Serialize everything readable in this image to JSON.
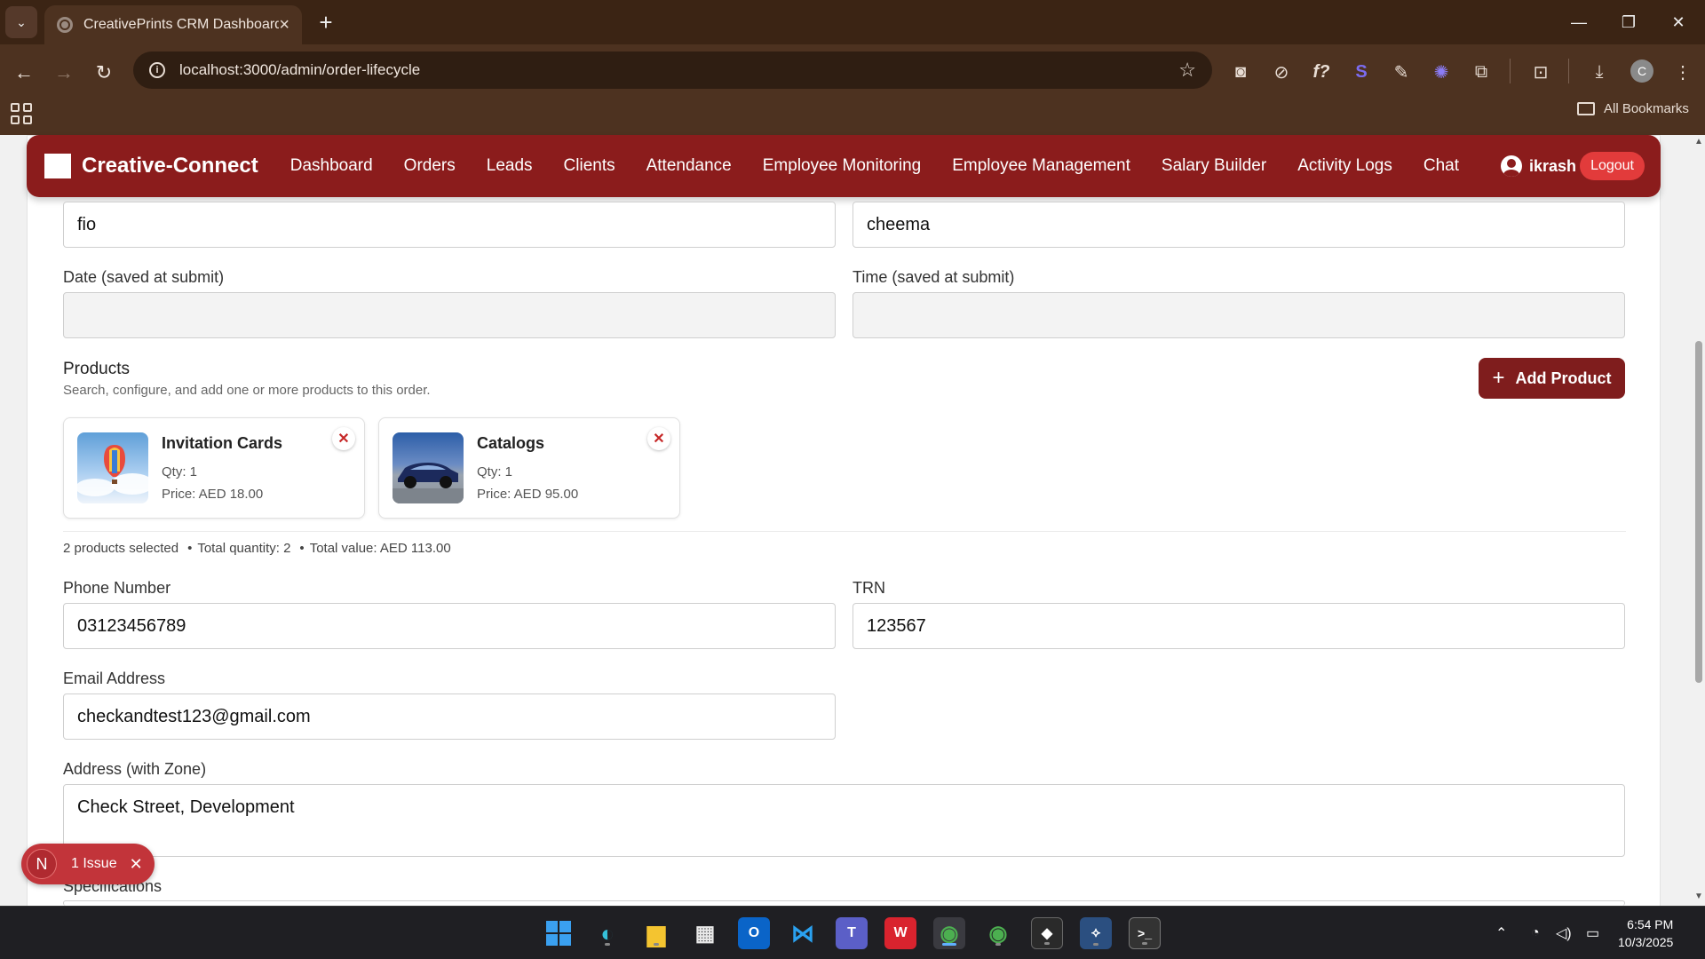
{
  "browser": {
    "tab_title": "CreativePrints CRM Dashboard",
    "url": "localhost:3000/admin/order-lifecycle",
    "bookmarks_label": "All Bookmarks",
    "profile_initial": "C"
  },
  "navbar": {
    "brand": "Creative-Connect",
    "links": [
      "Dashboard",
      "Orders",
      "Leads",
      "Clients",
      "Attendance",
      "Employee Monitoring",
      "Employee Management",
      "Salary Builder",
      "Activity Logs",
      "Chat"
    ],
    "username": "ikrash",
    "logout_label": "Logout",
    "color": "#8b1c1c"
  },
  "form": {
    "first_name_value": "fio",
    "last_name_value": "cheema",
    "date_label": "Date (saved at submit)",
    "time_label": "Time (saved at submit)",
    "products_title": "Products",
    "products_subtitle": "Search, configure, and add one or more products to this order.",
    "add_product_label": "Add Product",
    "products": [
      {
        "name": "Invitation Cards",
        "qty": "Qty: 1",
        "price": "Price: AED 18.00",
        "image": "hot-air-balloon"
      },
      {
        "name": "Catalogs",
        "qty": "Qty: 1",
        "price": "Price: AED 95.00",
        "image": "car"
      }
    ],
    "summary": {
      "selected": "2 products selected",
      "quantity": "Total quantity: 2",
      "value": "Total value: AED 113.00"
    },
    "phone_label": "Phone Number",
    "phone_value": "03123456789",
    "trn_label": "TRN",
    "trn_value": "123567",
    "email_label": "Email Address",
    "email_value": "checkandtest123@gmail.com",
    "address_label": "Address (with Zone)",
    "address_value": "Check Street, Development",
    "specifications_label": "Specifications"
  },
  "issue_badge": {
    "logo": "N",
    "text": "1 Issue"
  },
  "taskbar": {
    "time": "6:54 PM",
    "date": "10/3/2025"
  },
  "colors": {
    "accent": "#8b1c1c",
    "logout": "#e23b3b",
    "browser_frame": "#4d3220"
  }
}
